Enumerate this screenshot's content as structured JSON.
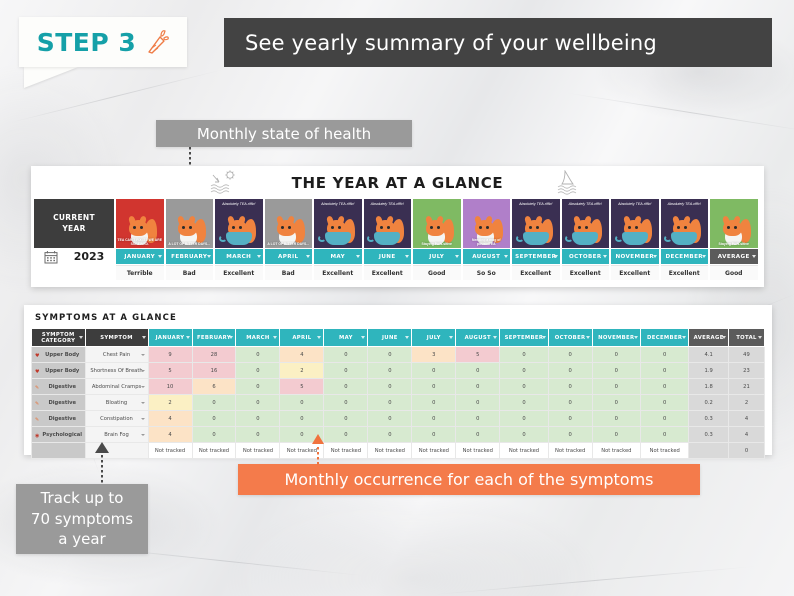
{
  "step": {
    "label": "STEP 3",
    "icon": "carrot-icon"
  },
  "banner": {
    "text": "See yearly summary of your wellbeing",
    "bg": "#434343"
  },
  "callouts": {
    "health": "Monthly state of health",
    "track": "Track up to\n70 symptoms\na year",
    "track_lines": [
      "Track up to",
      "70 symptoms",
      "a year"
    ],
    "occurrence": "Monthly occurrence for each of the symptoms",
    "occurrence_color": "#f47b4b",
    "grey_color": "#9a9a9a"
  },
  "year_panel": {
    "title": "THE YEAR AT A GLANCE",
    "left_header": "CURRENT\nYEAR",
    "left_header_lines": [
      "CURRENT",
      "YEAR"
    ],
    "year": "2023",
    "calendar_icon": "calendar-icon",
    "doodles": [
      "sun-sea-icon",
      "shark-fin-icon"
    ],
    "columns": [
      {
        "month": "JANUARY",
        "state": "Terrible",
        "card_bg": "#d1352f",
        "caption": "TEA CAN'T FIX IT? WE ARE SCREWED.",
        "caption_top": ""
      },
      {
        "month": "FEBRUARY",
        "state": "Bad",
        "card_bg": "#9a9a9a",
        "caption": "A LOT OF BITTER DAYS...",
        "caption_top": ""
      },
      {
        "month": "MARCH",
        "state": "Excellent",
        "card_bg": "#3a2f52",
        "caption": "",
        "caption_top": "Absolutely TEA-riffic!"
      },
      {
        "month": "APRIL",
        "state": "Bad",
        "card_bg": "#9a9a9a",
        "caption": "A LOT OF BITTER DAYS...",
        "caption_top": ""
      },
      {
        "month": "MAY",
        "state": "Excellent",
        "card_bg": "#3a2f52",
        "caption": "",
        "caption_top": "Absolutely TEA-riffic!"
      },
      {
        "month": "JUNE",
        "state": "Excellent",
        "card_bg": "#3a2f52",
        "caption": "",
        "caption_top": "Absolutely TEA-riffic!"
      },
      {
        "month": "JULY",
        "state": "Good",
        "card_bg": "#7fba63",
        "caption": "Staying PAW-sitive",
        "caption_top": ""
      },
      {
        "month": "AUGUST",
        "state": "So So",
        "card_bg": "#b07fc9",
        "caption": "Needing a mug of positiviTEA",
        "caption_top": ""
      },
      {
        "month": "SEPTEMBER",
        "state": "Excellent",
        "card_bg": "#3a2f52",
        "caption": "",
        "caption_top": "Absolutely TEA-riffic!"
      },
      {
        "month": "OCTOBER",
        "state": "Excellent",
        "card_bg": "#3a2f52",
        "caption": "",
        "caption_top": "Absolutely TEA-riffic!"
      },
      {
        "month": "NOVEMBER",
        "state": "Excellent",
        "card_bg": "#3a2f52",
        "caption": "",
        "caption_top": "Absolutely TEA-riffic!"
      },
      {
        "month": "DECEMBER",
        "state": "Excellent",
        "card_bg": "#3a2f52",
        "caption": "",
        "caption_top": "Absolutely TEA-riffic!"
      },
      {
        "month": "AVERAGE",
        "state": "Good",
        "card_bg": "#7fba63",
        "caption": "Staying PAW-sitive",
        "caption_top": "",
        "is_average": true
      }
    ]
  },
  "symptoms_panel": {
    "title": "SYMPTOMS AT A GLANCE",
    "headers": [
      {
        "label": "SYMPTOM\nCATEGORY",
        "lines": [
          "SYMPTOM",
          "CATEGORY"
        ],
        "style": "dark"
      },
      {
        "label": "SYMPTOM",
        "lines": [
          "SYMPTOM"
        ],
        "style": "dark"
      },
      {
        "label": "JANUARY",
        "lines": [
          "JANUARY"
        ],
        "style": "teal"
      },
      {
        "label": "FEBRUARY",
        "lines": [
          "FEBRUARY"
        ],
        "style": "teal"
      },
      {
        "label": "MARCH",
        "lines": [
          "MARCH"
        ],
        "style": "teal"
      },
      {
        "label": "APRIL",
        "lines": [
          "APRIL"
        ],
        "style": "teal"
      },
      {
        "label": "MAY",
        "lines": [
          "MAY"
        ],
        "style": "teal"
      },
      {
        "label": "JUNE",
        "lines": [
          "JUNE"
        ],
        "style": "teal"
      },
      {
        "label": "JULY",
        "lines": [
          "JULY"
        ],
        "style": "teal"
      },
      {
        "label": "AUGUST",
        "lines": [
          "AUGUST"
        ],
        "style": "teal"
      },
      {
        "label": "SEPTEMBER",
        "lines": [
          "SEPTEMBER"
        ],
        "style": "teal"
      },
      {
        "label": "OCTOBER",
        "lines": [
          "OCTOBER"
        ],
        "style": "teal"
      },
      {
        "label": "NOVEMBER",
        "lines": [
          "NOVEMBER"
        ],
        "style": "teal"
      },
      {
        "label": "DECEMBER",
        "lines": [
          "DECEMBER"
        ],
        "style": "teal"
      },
      {
        "label": "AVERAGE",
        "lines": [
          "AVERAGE"
        ],
        "style": "grey"
      },
      {
        "label": "TOTAL",
        "lines": [
          "TOTAL"
        ],
        "style": "grey"
      }
    ],
    "rows": [
      {
        "category": "Upper Body",
        "cat_icon": "heart-icon",
        "symptom": "Chest Pain",
        "values": [
          "9",
          "28",
          "0",
          "4",
          "0",
          "0",
          "3",
          "5",
          "0",
          "0",
          "0",
          "0"
        ],
        "tints": [
          "r",
          "r",
          "g",
          "o",
          "g",
          "g",
          "o",
          "r",
          "g",
          "g",
          "g",
          "g"
        ],
        "average": "4.1",
        "total": "49"
      },
      {
        "category": "Upper Body",
        "cat_icon": "heart-icon",
        "symptom": "Shortness Of Breath",
        "values": [
          "5",
          "16",
          "0",
          "2",
          "0",
          "0",
          "0",
          "0",
          "0",
          "0",
          "0",
          "0"
        ],
        "tints": [
          "r",
          "r",
          "g",
          "y",
          "g",
          "g",
          "g",
          "g",
          "g",
          "g",
          "g",
          "g"
        ],
        "average": "1.9",
        "total": "23"
      },
      {
        "category": "Digestive",
        "cat_icon": "pill-icon",
        "symptom": "Abdominal Cramps",
        "values": [
          "10",
          "6",
          "0",
          "5",
          "0",
          "0",
          "0",
          "0",
          "0",
          "0",
          "0",
          "0"
        ],
        "tints": [
          "r",
          "o",
          "g",
          "r",
          "g",
          "g",
          "g",
          "g",
          "g",
          "g",
          "g",
          "g"
        ],
        "average": "1.8",
        "total": "21"
      },
      {
        "category": "Digestive",
        "cat_icon": "pill-icon",
        "symptom": "Bloating",
        "values": [
          "2",
          "0",
          "0",
          "0",
          "0",
          "0",
          "0",
          "0",
          "0",
          "0",
          "0",
          "0"
        ],
        "tints": [
          "y",
          "g",
          "g",
          "g",
          "g",
          "g",
          "g",
          "g",
          "g",
          "g",
          "g",
          "g"
        ],
        "average": "0.2",
        "total": "2"
      },
      {
        "category": "Digestive",
        "cat_icon": "pill-icon",
        "symptom": "Constipation",
        "values": [
          "4",
          "0",
          "0",
          "0",
          "0",
          "0",
          "0",
          "0",
          "0",
          "0",
          "0",
          "0"
        ],
        "tints": [
          "o",
          "g",
          "g",
          "g",
          "g",
          "g",
          "g",
          "g",
          "g",
          "g",
          "g",
          "g"
        ],
        "average": "0.3",
        "total": "4"
      },
      {
        "category": "Psychological",
        "cat_icon": "brain-icon",
        "symptom": "Brain Fog",
        "values": [
          "4",
          "0",
          "0",
          "0",
          "0",
          "0",
          "0",
          "0",
          "0",
          "0",
          "0",
          "0"
        ],
        "tints": [
          "o",
          "g",
          "g",
          "g",
          "g",
          "g",
          "g",
          "g",
          "g",
          "g",
          "g",
          "g"
        ],
        "average": "0.3",
        "total": "4"
      }
    ],
    "untracked_row": {
      "label": "Not tracked",
      "values": [
        "Not tracked",
        "Not tracked",
        "Not tracked",
        "Not tracked",
        "Not tracked",
        "Not tracked",
        "Not tracked",
        "Not tracked",
        "Not tracked",
        "Not tracked",
        "Not tracked",
        "Not tracked"
      ],
      "average": "",
      "total": "0"
    },
    "teal": "#2fb5bd"
  }
}
